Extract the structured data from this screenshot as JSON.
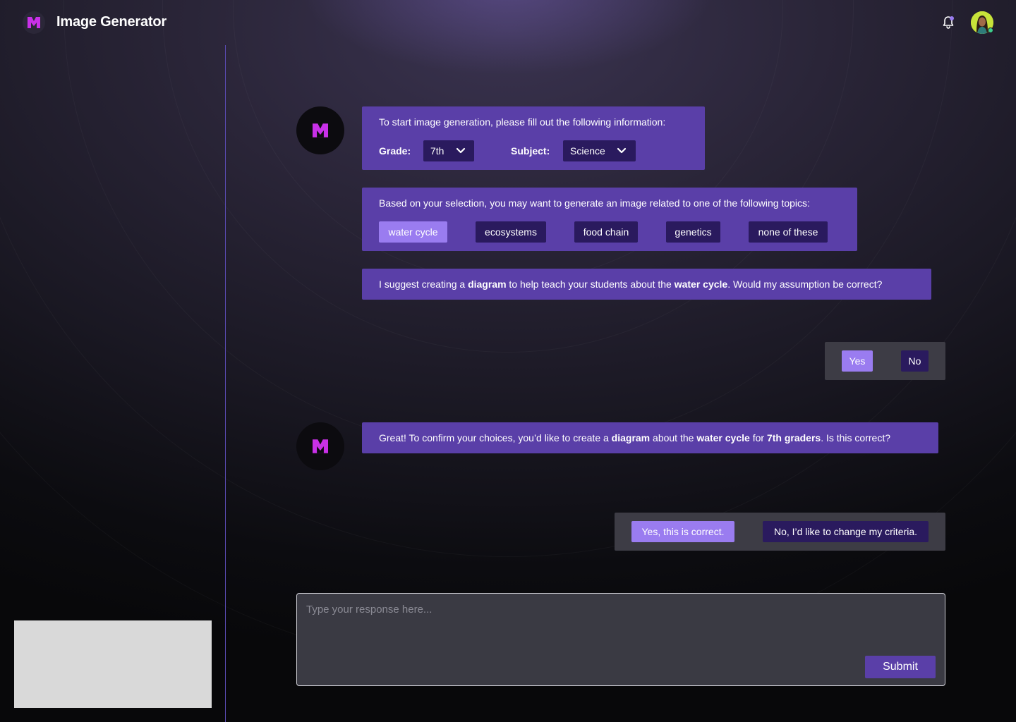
{
  "header": {
    "title": "Image Generator"
  },
  "input": {
    "placeholder": "Type your response here...",
    "submit_label": "Submit"
  },
  "messages": {
    "form": {
      "prompt": "To start image generation, please fill out the following information:",
      "grade_label": "Grade:",
      "grade_value": "7th",
      "subject_label": "Subject:",
      "subject_value": "Science"
    },
    "topics": {
      "prompt": "Based on your selection, you may want to generate an image related to one of the following topics:",
      "options": [
        "water cycle",
        "ecosystems",
        "food chain",
        "genetics",
        "none of these"
      ],
      "selected": "water cycle"
    },
    "suggestion": {
      "t1": "I suggest creating a ",
      "b1": "diagram",
      "t2": " to help teach your students about the ",
      "b2": "water cycle",
      "t3": ". Would my assumption be correct?"
    },
    "reply1": {
      "yes": "Yes",
      "no": "No",
      "selected": "Yes"
    },
    "confirm": {
      "t1": "Great! To confirm your choices, you’d like to create a ",
      "b1": "diagram",
      "t2": " about the ",
      "b2": "water cycle",
      "t3": " for ",
      "b3": "7th graders",
      "t4": ". Is this correct?"
    },
    "reply2": {
      "yes": "Yes, this is correct.",
      "no": "No, I’d like to change my criteria.",
      "selected": "Yes, this is correct."
    }
  },
  "colors": {
    "accent": "#5a3fa8",
    "accent_light": "#9a7cf0",
    "chip_dark": "#2a1a5e",
    "brand_magenta": "#c930e8"
  }
}
